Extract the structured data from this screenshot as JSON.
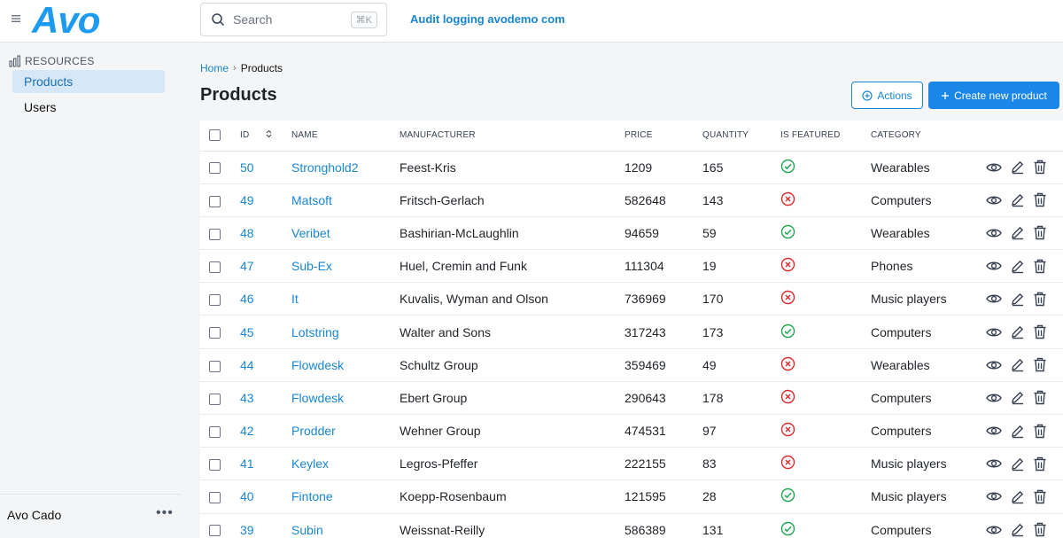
{
  "header": {
    "logo_text": "Avo",
    "search_placeholder": "Search",
    "search_shortcut": "⌘K",
    "top_link": "Audit logging avodemo com"
  },
  "sidebar": {
    "section_label": "RESOURCES",
    "items": [
      {
        "label": "Products",
        "active": true
      },
      {
        "label": "Users",
        "active": false
      }
    ],
    "user_name": "Avo Cado",
    "more_label": "•••"
  },
  "breadcrumb": {
    "home": "Home",
    "current": "Products"
  },
  "page": {
    "title": "Products",
    "actions_label": "Actions",
    "create_label": "Create new product"
  },
  "table": {
    "columns": [
      "ID",
      "NAME",
      "MANUFACTURER",
      "PRICE",
      "QUANTITY",
      "IS FEATURED",
      "CATEGORY"
    ],
    "rows": [
      {
        "id": "50",
        "name": "Stronghold2",
        "manufacturer": "Feest-Kris",
        "price": "1209",
        "quantity": "165",
        "featured": true,
        "category": "Wearables"
      },
      {
        "id": "49",
        "name": "Matsoft",
        "manufacturer": "Fritsch-Gerlach",
        "price": "582648",
        "quantity": "143",
        "featured": false,
        "category": "Computers"
      },
      {
        "id": "48",
        "name": "Veribet",
        "manufacturer": "Bashirian-McLaughlin",
        "price": "94659",
        "quantity": "59",
        "featured": true,
        "category": "Wearables"
      },
      {
        "id": "47",
        "name": "Sub-Ex",
        "manufacturer": "Huel, Cremin and Funk",
        "price": "111304",
        "quantity": "19",
        "featured": false,
        "category": "Phones"
      },
      {
        "id": "46",
        "name": "It",
        "manufacturer": "Kuvalis, Wyman and Olson",
        "price": "736969",
        "quantity": "170",
        "featured": false,
        "category": "Music players"
      },
      {
        "id": "45",
        "name": "Lotstring",
        "manufacturer": "Walter and Sons",
        "price": "317243",
        "quantity": "173",
        "featured": true,
        "category": "Computers"
      },
      {
        "id": "44",
        "name": "Flowdesk",
        "manufacturer": "Schultz Group",
        "price": "359469",
        "quantity": "49",
        "featured": false,
        "category": "Wearables"
      },
      {
        "id": "43",
        "name": "Flowdesk",
        "manufacturer": "Ebert Group",
        "price": "290643",
        "quantity": "178",
        "featured": false,
        "category": "Computers"
      },
      {
        "id": "42",
        "name": "Prodder",
        "manufacturer": "Wehner Group",
        "price": "474531",
        "quantity": "97",
        "featured": false,
        "category": "Computers"
      },
      {
        "id": "41",
        "name": "Keylex",
        "manufacturer": "Legros-Pfeffer",
        "price": "222155",
        "quantity": "83",
        "featured": false,
        "category": "Music players"
      },
      {
        "id": "40",
        "name": "Fintone",
        "manufacturer": "Koepp-Rosenbaum",
        "price": "121595",
        "quantity": "28",
        "featured": true,
        "category": "Music players"
      },
      {
        "id": "39",
        "name": "Subin",
        "manufacturer": "Weissnat-Reilly",
        "price": "586389",
        "quantity": "131",
        "featured": true,
        "category": "Computers"
      }
    ]
  },
  "icons": {
    "search": "search-icon",
    "featured_true": "check-circle-icon",
    "featured_false": "x-circle-icon",
    "view": "eye-icon",
    "edit": "pencil-icon",
    "delete": "trash-icon"
  },
  "colors": {
    "accent": "#1a86d0",
    "primary_button": "#1a86e8",
    "success": "#22a553",
    "danger": "#d92d2d",
    "active_nav_bg": "#d6e8f8"
  }
}
